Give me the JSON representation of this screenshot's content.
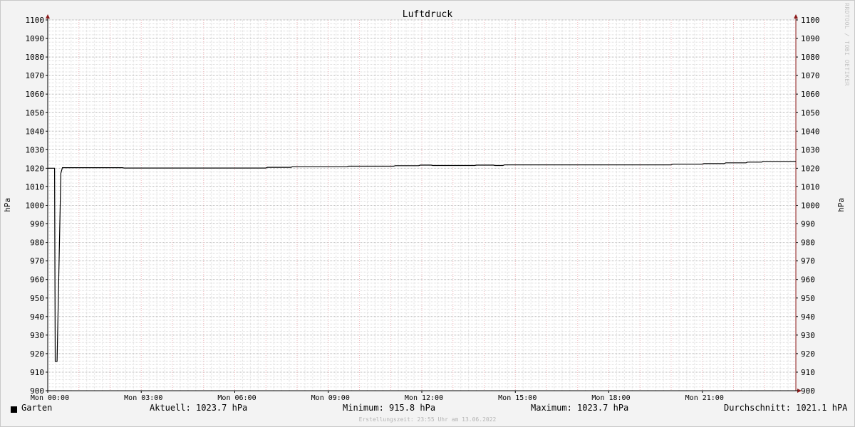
{
  "chart_data": {
    "type": "line",
    "title": "Luftdruck",
    "ylabel": "hPa",
    "ylabel_right": "hPa",
    "ylim": [
      900,
      1100
    ],
    "y_ticks": [
      900,
      910,
      920,
      930,
      940,
      950,
      960,
      970,
      980,
      990,
      1000,
      1010,
      1020,
      1030,
      1040,
      1050,
      1060,
      1070,
      1080,
      1090,
      1100
    ],
    "xlim_hours": [
      0,
      24
    ],
    "x_ticks": [
      {
        "hour": 0,
        "label": "Mon 00:00"
      },
      {
        "hour": 3,
        "label": "Mon 03:00"
      },
      {
        "hour": 6,
        "label": "Mon 06:00"
      },
      {
        "hour": 9,
        "label": "Mon 09:00"
      },
      {
        "hour": 12,
        "label": "Mon 12:00"
      },
      {
        "hour": 15,
        "label": "Mon 15:00"
      },
      {
        "hour": 18,
        "label": "Mon 18:00"
      },
      {
        "hour": 21,
        "label": "Mon 21:00"
      }
    ],
    "grid": true,
    "series": [
      {
        "name": "Garten",
        "color": "#000000",
        "points": [
          [
            0.0,
            1020.0
          ],
          [
            0.22,
            1020.0
          ],
          [
            0.24,
            915.8
          ],
          [
            0.3,
            915.8
          ],
          [
            0.42,
            1017.3
          ],
          [
            0.47,
            1020.3
          ],
          [
            2.4,
            1020.3
          ],
          [
            2.45,
            1020.1
          ],
          [
            7.0,
            1020.1
          ],
          [
            7.05,
            1020.5
          ],
          [
            7.8,
            1020.5
          ],
          [
            7.85,
            1020.8
          ],
          [
            9.6,
            1020.8
          ],
          [
            9.65,
            1021.1
          ],
          [
            11.1,
            1021.1
          ],
          [
            11.15,
            1021.4
          ],
          [
            11.9,
            1021.4
          ],
          [
            11.95,
            1021.7
          ],
          [
            12.3,
            1021.7
          ],
          [
            12.35,
            1021.5
          ],
          [
            13.7,
            1021.5
          ],
          [
            13.75,
            1021.7
          ],
          [
            14.3,
            1021.7
          ],
          [
            14.35,
            1021.5
          ],
          [
            14.6,
            1021.5
          ],
          [
            14.65,
            1021.8
          ],
          [
            20.0,
            1021.8
          ],
          [
            20.05,
            1022.2
          ],
          [
            21.0,
            1022.2
          ],
          [
            21.05,
            1022.5
          ],
          [
            21.7,
            1022.5
          ],
          [
            21.75,
            1022.9
          ],
          [
            22.4,
            1022.9
          ],
          [
            22.45,
            1023.3
          ],
          [
            22.9,
            1023.3
          ],
          [
            22.95,
            1023.7
          ],
          [
            24.0,
            1023.7
          ]
        ]
      }
    ]
  },
  "legend": {
    "series_name": "Garten",
    "current": "Aktuell: 1023.7 hPa",
    "minimum": "Minimum: 915.8 hPa",
    "maximum": "Maximum: 1023.7 hPa",
    "average": "Durchschnitt: 1021.1 hPA"
  },
  "footer": "Erstellungszeit: 23:55 Uhr am 13.06.2022",
  "watermark": "RRDTOOL / TOBI OETIKER"
}
